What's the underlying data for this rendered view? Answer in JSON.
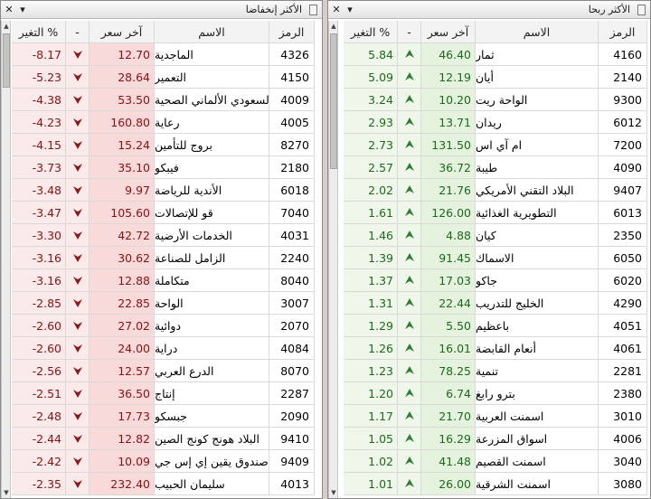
{
  "left_panel": {
    "title": "الأكثر إنخفاضا",
    "minimize_glyph": "▾",
    "close_glyph": "✕",
    "headers": {
      "change": "التغير %",
      "dir": "-",
      "price": "آخر سعر",
      "name": "الاسم",
      "code": "الرمز"
    },
    "rows": [
      {
        "change": "-8.17",
        "price": "12.70",
        "name": "الماجدية",
        "code": "4326"
      },
      {
        "change": "-5.23",
        "price": "28.64",
        "name": "التعمير",
        "code": "4150"
      },
      {
        "change": "-4.38",
        "price": "53.50",
        "name": "السعودي الألماني الصحية",
        "code": "4009"
      },
      {
        "change": "-4.23",
        "price": "160.80",
        "name": "رعاية",
        "code": "4005"
      },
      {
        "change": "-4.15",
        "price": "15.24",
        "name": "بروج للتأمين",
        "code": "8270"
      },
      {
        "change": "-3.73",
        "price": "35.10",
        "name": "فيبكو",
        "code": "2180"
      },
      {
        "change": "-3.48",
        "price": "9.97",
        "name": "الأندية للرياضة",
        "code": "6018"
      },
      {
        "change": "-3.47",
        "price": "105.60",
        "name": "قو للإتصالات",
        "code": "7040"
      },
      {
        "change": "-3.30",
        "price": "42.72",
        "name": "الخدمات الأرضية",
        "code": "4031"
      },
      {
        "change": "-3.16",
        "price": "30.62",
        "name": "الزامل للصناعة",
        "code": "2240"
      },
      {
        "change": "-3.16",
        "price": "12.88",
        "name": "متكاملة",
        "code": "8040"
      },
      {
        "change": "-2.85",
        "price": "22.85",
        "name": "الواحة",
        "code": "3007"
      },
      {
        "change": "-2.60",
        "price": "27.02",
        "name": "دوائية",
        "code": "2070"
      },
      {
        "change": "-2.60",
        "price": "24.00",
        "name": "دراية",
        "code": "4084"
      },
      {
        "change": "-2.56",
        "price": "12.57",
        "name": "الدرع العربي",
        "code": "8070"
      },
      {
        "change": "-2.51",
        "price": "36.50",
        "name": "إنتاج",
        "code": "2287"
      },
      {
        "change": "-2.48",
        "price": "17.73",
        "name": "جبسكو",
        "code": "2090"
      },
      {
        "change": "-2.44",
        "price": "12.82",
        "name": "البلاد هونج كونج الصين",
        "code": "9410"
      },
      {
        "change": "-2.42",
        "price": "10.09",
        "name": "صندوق يقين إي إس جي",
        "code": "9409"
      },
      {
        "change": "-2.35",
        "price": "232.40",
        "name": "سليمان الحبيب",
        "code": "4013"
      }
    ]
  },
  "right_panel": {
    "title": "الأكثر ربحا",
    "minimize_glyph": "▾",
    "close_glyph": "✕",
    "headers": {
      "change": "التغير %",
      "dir": "-",
      "price": "آخر سعر",
      "name": "الاسم",
      "code": "الرمز"
    },
    "rows": [
      {
        "change": "5.84",
        "price": "46.40",
        "name": "ثمار",
        "code": "4160"
      },
      {
        "change": "5.09",
        "price": "12.19",
        "name": "أيان",
        "code": "2140"
      },
      {
        "change": "3.24",
        "price": "10.20",
        "name": "الواحة ريت",
        "code": "9300"
      },
      {
        "change": "2.93",
        "price": "13.71",
        "name": "ريدان",
        "code": "6012"
      },
      {
        "change": "2.73",
        "price": "131.50",
        "name": "ام آي اس",
        "code": "7200"
      },
      {
        "change": "2.57",
        "price": "36.72",
        "name": "طيبة",
        "code": "4090"
      },
      {
        "change": "2.02",
        "price": "21.76",
        "name": "البلاد التقني الأمريكي",
        "code": "9407"
      },
      {
        "change": "1.61",
        "price": "126.00",
        "name": "التطويرية الغذائية",
        "code": "6013"
      },
      {
        "change": "1.46",
        "price": "4.88",
        "name": "كيان",
        "code": "2350"
      },
      {
        "change": "1.39",
        "price": "91.45",
        "name": "الاسماك",
        "code": "6050"
      },
      {
        "change": "1.37",
        "price": "17.03",
        "name": "جاكو",
        "code": "6020"
      },
      {
        "change": "1.31",
        "price": "22.44",
        "name": "الخليج للتدريب",
        "code": "4290"
      },
      {
        "change": "1.29",
        "price": "5.50",
        "name": "باعظيم",
        "code": "4051"
      },
      {
        "change": "1.26",
        "price": "16.01",
        "name": "أنعام القابضة",
        "code": "4061"
      },
      {
        "change": "1.23",
        "price": "78.25",
        "name": "تنمية",
        "code": "2281"
      },
      {
        "change": "1.20",
        "price": "6.74",
        "name": "بترو رابغ",
        "code": "2380"
      },
      {
        "change": "1.17",
        "price": "21.70",
        "name": "اسمنت العربية",
        "code": "3010"
      },
      {
        "change": "1.05",
        "price": "16.29",
        "name": "اسواق المزرعة",
        "code": "4006"
      },
      {
        "change": "1.02",
        "price": "41.48",
        "name": "اسمنت القصيم",
        "code": "3040"
      },
      {
        "change": "1.01",
        "price": "26.00",
        "name": "اسمنت الشرقية",
        "code": "3080"
      }
    ]
  },
  "colors": {
    "negative_text": "#8a1212",
    "positive_text": "#1c6a1c",
    "down_arrow": "#8b1a1a",
    "up_arrow": "#2e7d32"
  },
  "icons": {
    "down": "down-arrow-icon",
    "up": "up-arrow-icon"
  }
}
